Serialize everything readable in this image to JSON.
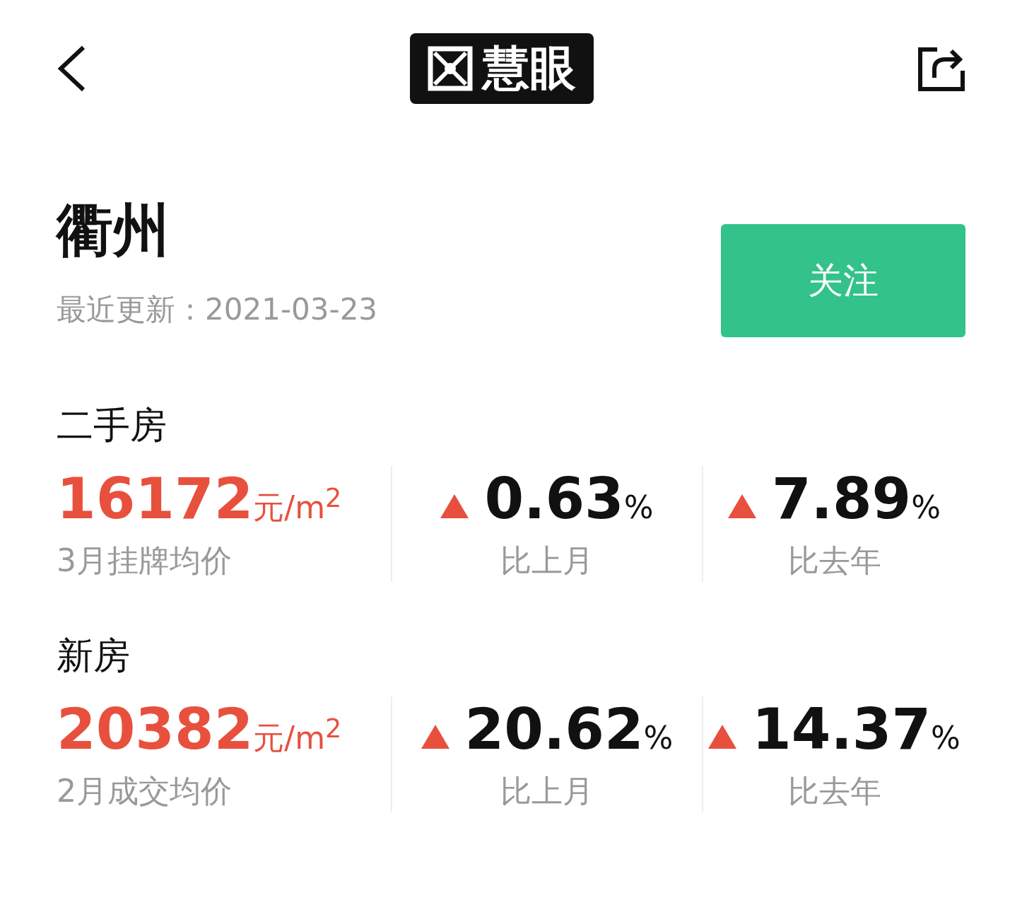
{
  "header": {
    "logo_text": "慧眼"
  },
  "city": {
    "name": "衢州",
    "updated": "最近更新：2021-03-23",
    "follow_button": "关注"
  },
  "sections": [
    {
      "title": "二手房",
      "price": "16172",
      "unit": "元/m$^{2}$",
      "label": "3月挂牌均价",
      "changes": [
        {
          "kind": "up",
          "value": "0.63",
          "unit": "%",
          "label": "比上月"
        },
        {
          "kind": "up",
          "value": "7.89",
          "unit": "%",
          "label": "比去年"
        }
      ]
    },
    {
      "title": "新房",
      "price": "20382",
      "unit": "元/m$^{2}$",
      "label": "2月成交均价",
      "changes": [
        {
          "kind": "up",
          "value": "20.62",
          "unit": "%",
          "label": "比上月"
        },
        {
          "kind": "up",
          "value": "14.37",
          "unit": "%",
          "label": "比去年"
        }
      ]
    }
  ]
}
